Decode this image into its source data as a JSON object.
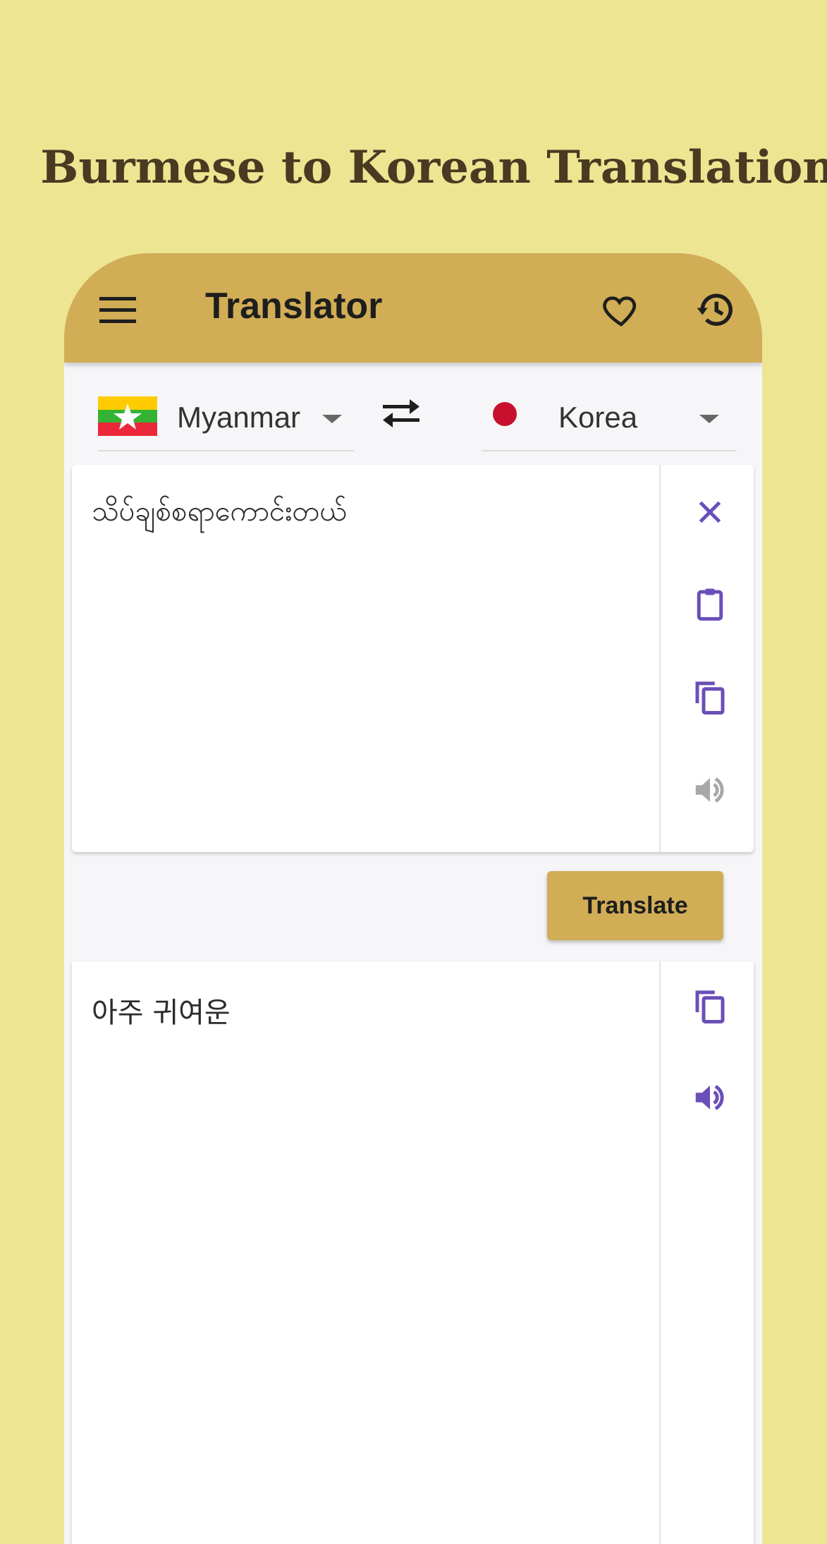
{
  "promo": {
    "title": "Burmese to Korean Translation"
  },
  "appbar": {
    "title": "Translator",
    "menu_icon": "menu-icon",
    "favorite_icon": "heart-icon",
    "history_icon": "history-icon"
  },
  "languages": {
    "source": {
      "label": "Myanmar",
      "flag": "myanmar-flag"
    },
    "target": {
      "label": "Korea",
      "flag": "korea-flag"
    },
    "swap_icon": "swap-arrows-icon"
  },
  "source_panel": {
    "text": "သိပ်ချစ်စရာကောင်းတယ်",
    "icons": [
      "close-icon",
      "paste-icon",
      "copy-icon",
      "speaker-icon"
    ]
  },
  "actions": {
    "translate_label": "Translate"
  },
  "target_panel": {
    "text": "아주 귀여운",
    "icons": [
      "copy-icon",
      "speaker-icon"
    ]
  },
  "colors": {
    "background": "#EDE592",
    "appbar": "#D1AD56",
    "accent_icon": "#6A4FB8",
    "disabled_icon": "#A8A8A8"
  }
}
